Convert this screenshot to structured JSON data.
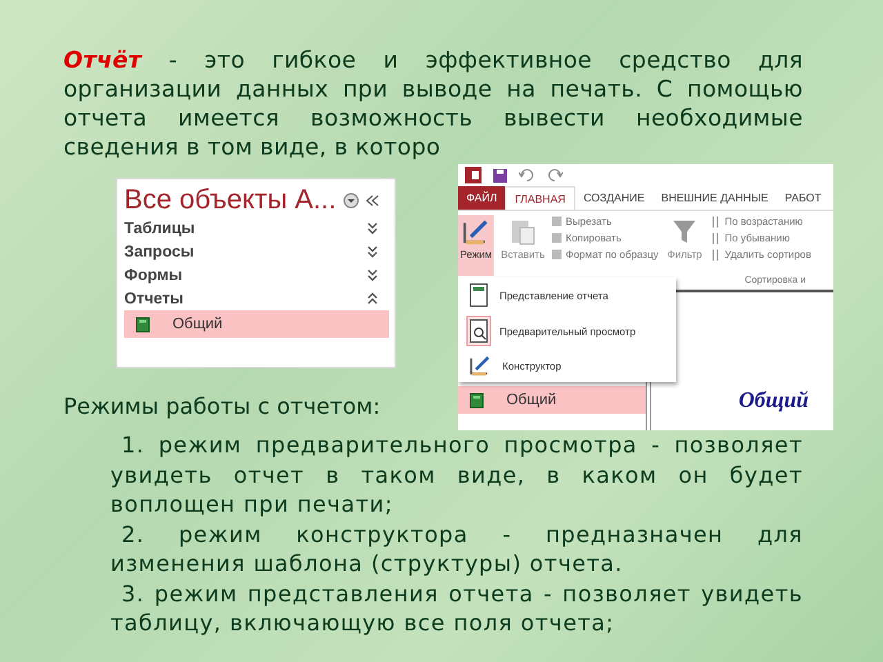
{
  "intro": {
    "term": "Отчёт",
    "text": " - это гибкое и эффективное средство для организации данных при выводе на печать. С помощью отчета имеется возможность вывести необходимые сведения в том виде, в которо"
  },
  "nav_pane": {
    "title": "Все объекты A...",
    "groups": [
      {
        "label": "Таблицы",
        "expanded": false
      },
      {
        "label": "Запросы",
        "expanded": false
      },
      {
        "label": "Формы",
        "expanded": false
      },
      {
        "label": "Отчеты",
        "expanded": true
      }
    ],
    "items": [
      {
        "label": "Общий",
        "selected": true
      }
    ]
  },
  "access_window": {
    "tabs": [
      {
        "label": "ФАЙЛ",
        "kind": "file",
        "selected": false
      },
      {
        "label": "ГЛАВНАЯ",
        "kind": "tab",
        "selected": true
      },
      {
        "label": "СОЗДАНИЕ",
        "kind": "tab",
        "selected": false
      },
      {
        "label": "ВНЕШНИЕ ДАННЫЕ",
        "kind": "tab",
        "selected": false
      },
      {
        "label": "РАБОТ",
        "kind": "tab",
        "selected": false
      }
    ],
    "mode_button": "Режим",
    "paste_button": "Вставить",
    "clipboard_actions": [
      "Вырезать",
      "Копировать",
      "Формат по образцу"
    ],
    "filter_button": "Фильтр",
    "sort_actions": [
      "По возрастанию",
      "По убыванию",
      "Удалить сортиров"
    ],
    "group_label": "Сортировка и",
    "menu": [
      {
        "label": "Представление отчета",
        "kind": "report",
        "selected": false
      },
      {
        "label": "Предварительный просмотр",
        "kind": "preview",
        "selected": true
      },
      {
        "label": "Конструктор",
        "kind": "design",
        "selected": false
      }
    ],
    "nav_item": {
      "label": "Общий",
      "selected": true
    },
    "report_title": "Общий"
  },
  "modes_heading": "Режимы работы с отчетом:",
  "modes": [
    "1. режим предварительного просмотра - позволяет увидеть отчет в таком виде, в каком он будет воплощен при печати;",
    "2. режим конструктора - предназначен для изменения шаблона (структуры) отчета.",
    "3.  режим представления отчета - позволяет увидеть таблицу, включающую все поля отчета;"
  ]
}
